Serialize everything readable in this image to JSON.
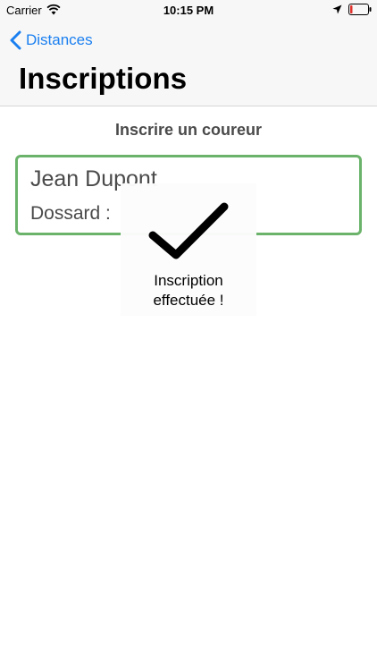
{
  "status_bar": {
    "carrier": "Carrier",
    "time": "10:15 PM",
    "icons": [
      "wifi-icon",
      "location-arrow-icon",
      "battery-low-icon"
    ]
  },
  "nav": {
    "back_label": "Distances",
    "title": "Inscriptions",
    "accent_color": "#1a7ff0"
  },
  "form": {
    "heading": "Inscrire un coureur",
    "runner_name": "Jean Dupont",
    "bib_label": "Dossard : ",
    "border_color": "#6bb36b"
  },
  "hud": {
    "icon": "checkmark-icon",
    "message_line1": "Inscription",
    "message_line2": "effectuée !"
  }
}
